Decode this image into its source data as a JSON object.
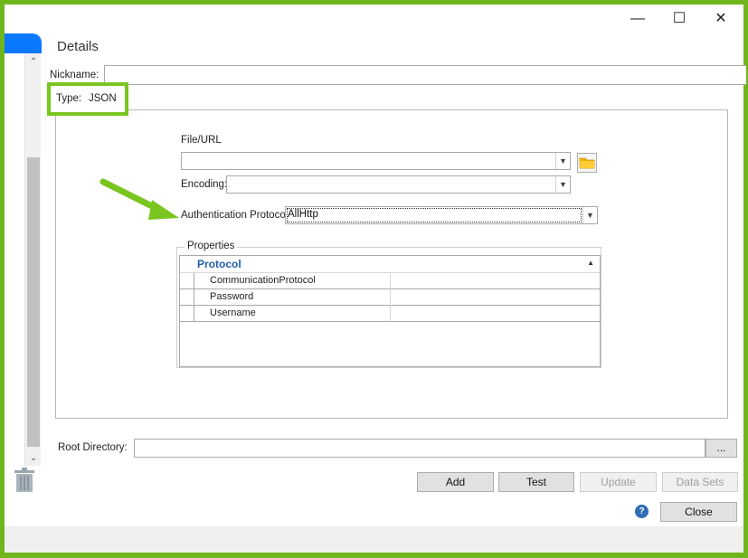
{
  "titlebar": {
    "minimize_glyph": "—",
    "maximize_glyph": "☐",
    "close_glyph": "✕"
  },
  "details": {
    "title": "Details",
    "nickname_label": "Nickname:",
    "nickname_value": "",
    "type_label": "Type:",
    "type_value": "JSON"
  },
  "connection": {
    "file_url_label": "File/URL",
    "file_url_value": "",
    "encoding_label": "Encoding:",
    "encoding_value": "",
    "auth_label": "Authentication Protocol",
    "auth_value": "AllHttp"
  },
  "properties": {
    "legend": "Properties",
    "category": "Protocol",
    "rows": [
      {
        "name": "CommunicationProtocol",
        "value": ""
      },
      {
        "name": "Password",
        "value": ""
      },
      {
        "name": "Username",
        "value": ""
      }
    ]
  },
  "root_directory": {
    "label": "Root Directory:",
    "value": "",
    "browse_label": "..."
  },
  "buttons": {
    "add": "Add",
    "test": "Test",
    "update": "Update",
    "data_sets": "Data Sets",
    "close": "Close",
    "help": "?"
  },
  "colors": {
    "accent_green": "#6fb61c",
    "tab_blue": "#0a78ff",
    "category_blue": "#1f5fa8"
  },
  "icons": [
    "minimize-icon",
    "maximize-icon",
    "close-icon",
    "folder-icon",
    "trash-icon",
    "help-icon",
    "chevron-down-icon",
    "chevron-up-icon",
    "annotation-arrow-icon"
  ]
}
